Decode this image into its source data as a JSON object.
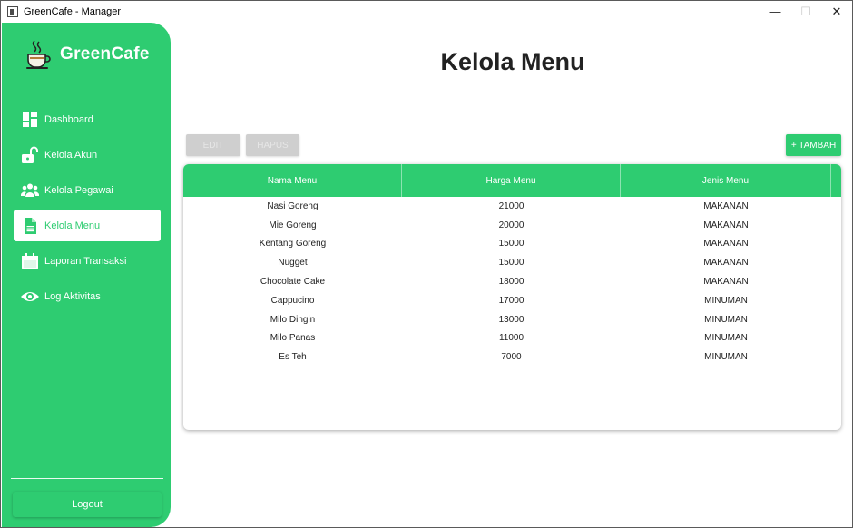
{
  "window": {
    "title": "GreenCafe - Manager",
    "minimize": "—",
    "maximize": "☐",
    "close": "✕"
  },
  "sidebar": {
    "brand": "GreenCafe",
    "items": [
      {
        "label": "Dashboard",
        "icon": "dashboard-icon",
        "active": false
      },
      {
        "label": "Kelola Akun",
        "icon": "unlock-icon",
        "active": false
      },
      {
        "label": "Kelola Pegawai",
        "icon": "users-icon",
        "active": false
      },
      {
        "label": "Kelola Menu",
        "icon": "document-icon",
        "active": true
      },
      {
        "label": "Laporan Transaksi",
        "icon": "calendar-icon",
        "active": false
      },
      {
        "label": "Log Aktivitas",
        "icon": "eye-icon",
        "active": false
      }
    ],
    "logout": "Logout"
  },
  "main": {
    "title": "Kelola Menu",
    "buttons": {
      "edit": "EDIT",
      "hapus": "HAPUS",
      "tambah": "+ TAMBAH"
    },
    "table": {
      "columns": [
        "Nama Menu",
        "Harga Menu",
        "Jenis Menu"
      ],
      "rows": [
        [
          "Nasi Goreng",
          "21000",
          "MAKANAN"
        ],
        [
          "Mie Goreng",
          "20000",
          "MAKANAN"
        ],
        [
          "Kentang Goreng",
          "15000",
          "MAKANAN"
        ],
        [
          "Nugget",
          "15000",
          "MAKANAN"
        ],
        [
          "Chocolate Cake",
          "18000",
          "MAKANAN"
        ],
        [
          "Cappucino",
          "17000",
          "MINUMAN"
        ],
        [
          "Milo Dingin",
          "13000",
          "MINUMAN"
        ],
        [
          "Milo Panas",
          "11000",
          "MINUMAN"
        ],
        [
          "Es Teh",
          "7000",
          "MINUMAN"
        ]
      ]
    }
  },
  "colors": {
    "accent": "#2ecc71",
    "text": "#222222"
  }
}
